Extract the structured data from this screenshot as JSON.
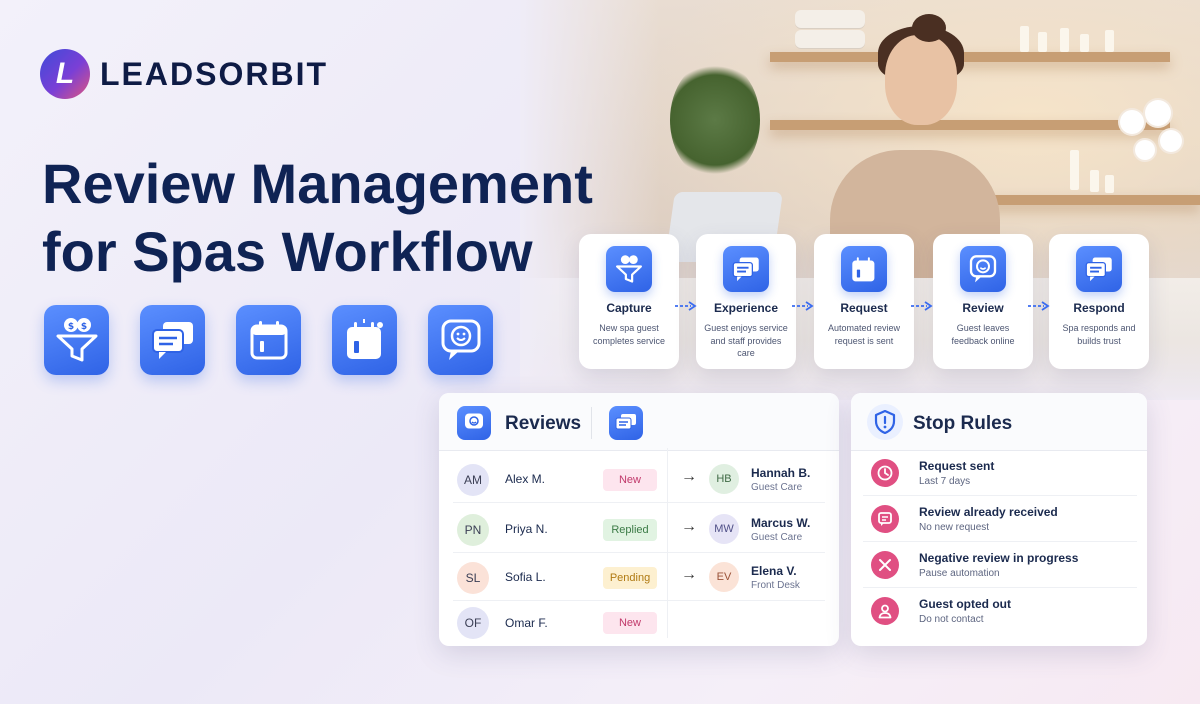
{
  "brand": {
    "mark_letter": "L",
    "name": "LEADSORBIT"
  },
  "hero": {
    "title_line1": "Review Management",
    "title_line2": "for Spas Workflow"
  },
  "hero_icons": [
    {
      "icon": "funnel-icon"
    },
    {
      "icon": "chat-bubbles-icon"
    },
    {
      "icon": "calendar-icon"
    },
    {
      "icon": "calendar-notification-icon"
    },
    {
      "icon": "smiley-chat-icon"
    }
  ],
  "workflow": [
    {
      "title": "Capture",
      "desc": "New spa guest completes service",
      "icon": "funnel-icon"
    },
    {
      "title": "Experience",
      "desc": "Guest enjoys service and staff provides care",
      "icon": "chat-bubbles-icon"
    },
    {
      "title": "Request",
      "desc": "Automated review request is sent",
      "icon": "calendar-notification-icon"
    },
    {
      "title": "Review",
      "desc": "Guest leaves feedback online",
      "icon": "smiley-chat-icon"
    },
    {
      "title": "Respond",
      "desc": "Spa responds and builds trust",
      "icon": "chat-bubbles-icon"
    }
  ],
  "reviews": {
    "title": "Reviews",
    "rows": [
      {
        "initials": "AM",
        "name": "Alex M.",
        "status": "New",
        "assignee_initials": "HB",
        "assignee": "Hannah B.",
        "role": "Guest Care"
      },
      {
        "initials": "PN",
        "name": "Priya N.",
        "status": "Replied",
        "assignee_initials": "MW",
        "assignee": "Marcus W.",
        "role": "Guest Care"
      },
      {
        "initials": "SL",
        "name": "Sofia L.",
        "status": "Pending",
        "assignee_initials": "EV",
        "assignee": "Elena V.",
        "role": "Front Desk"
      },
      {
        "initials": "OF",
        "name": "Omar F.",
        "status": "New"
      }
    ],
    "arrow_glyph": "→"
  },
  "stop_rules": {
    "title": "Stop Rules",
    "items": [
      {
        "title": "Request sent",
        "sub": "Last 7 days",
        "icon": "clock-icon"
      },
      {
        "title": "Review already received",
        "sub": "No new request",
        "icon": "message-icon"
      },
      {
        "title": "Negative review in progress",
        "sub": "Pause automation",
        "icon": "x-icon"
      },
      {
        "title": "Guest opted out",
        "sub": "Do not contact",
        "icon": "user-icon"
      }
    ]
  },
  "colors": {
    "accent_blue": "#2f63e6",
    "rule_pink": "#e04f82",
    "navy": "#0f2354"
  }
}
